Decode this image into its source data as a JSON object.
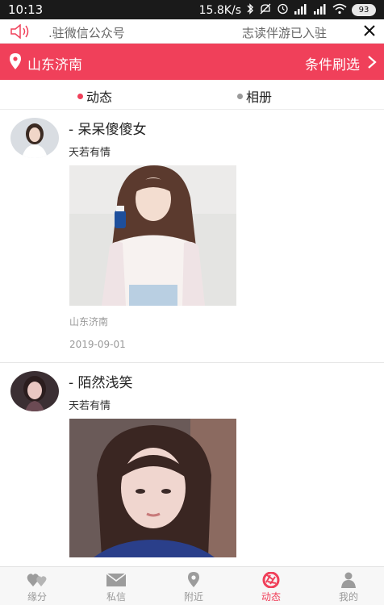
{
  "status_bar": {
    "time": "10:13",
    "network_speed": "15.8K/s",
    "battery": "93"
  },
  "notice": {
    "text_left": ".驻微信公众号",
    "text_right": "志读伴游已入驻"
  },
  "header": {
    "city": "山东济南",
    "filter_label": "条件刷选",
    "accent_color": "#f0405a"
  },
  "tabs": [
    {
      "label": "动态",
      "active": true
    },
    {
      "label": "相册",
      "active": false
    }
  ],
  "posts": [
    {
      "username": "- 呆呆傻傻女",
      "signature": "天若有情",
      "location": "山东济南",
      "date": "2019-09-01"
    },
    {
      "username": "- 陌然浅笑",
      "signature": "天若有情"
    }
  ],
  "bottom_nav": [
    {
      "label": "缘分",
      "icon": "hearts-icon"
    },
    {
      "label": "私信",
      "icon": "envelope-icon"
    },
    {
      "label": "附近",
      "icon": "location-pin-icon"
    },
    {
      "label": "动态",
      "icon": "camera-aperture-icon",
      "active": true
    },
    {
      "label": "我的",
      "icon": "person-icon"
    }
  ]
}
